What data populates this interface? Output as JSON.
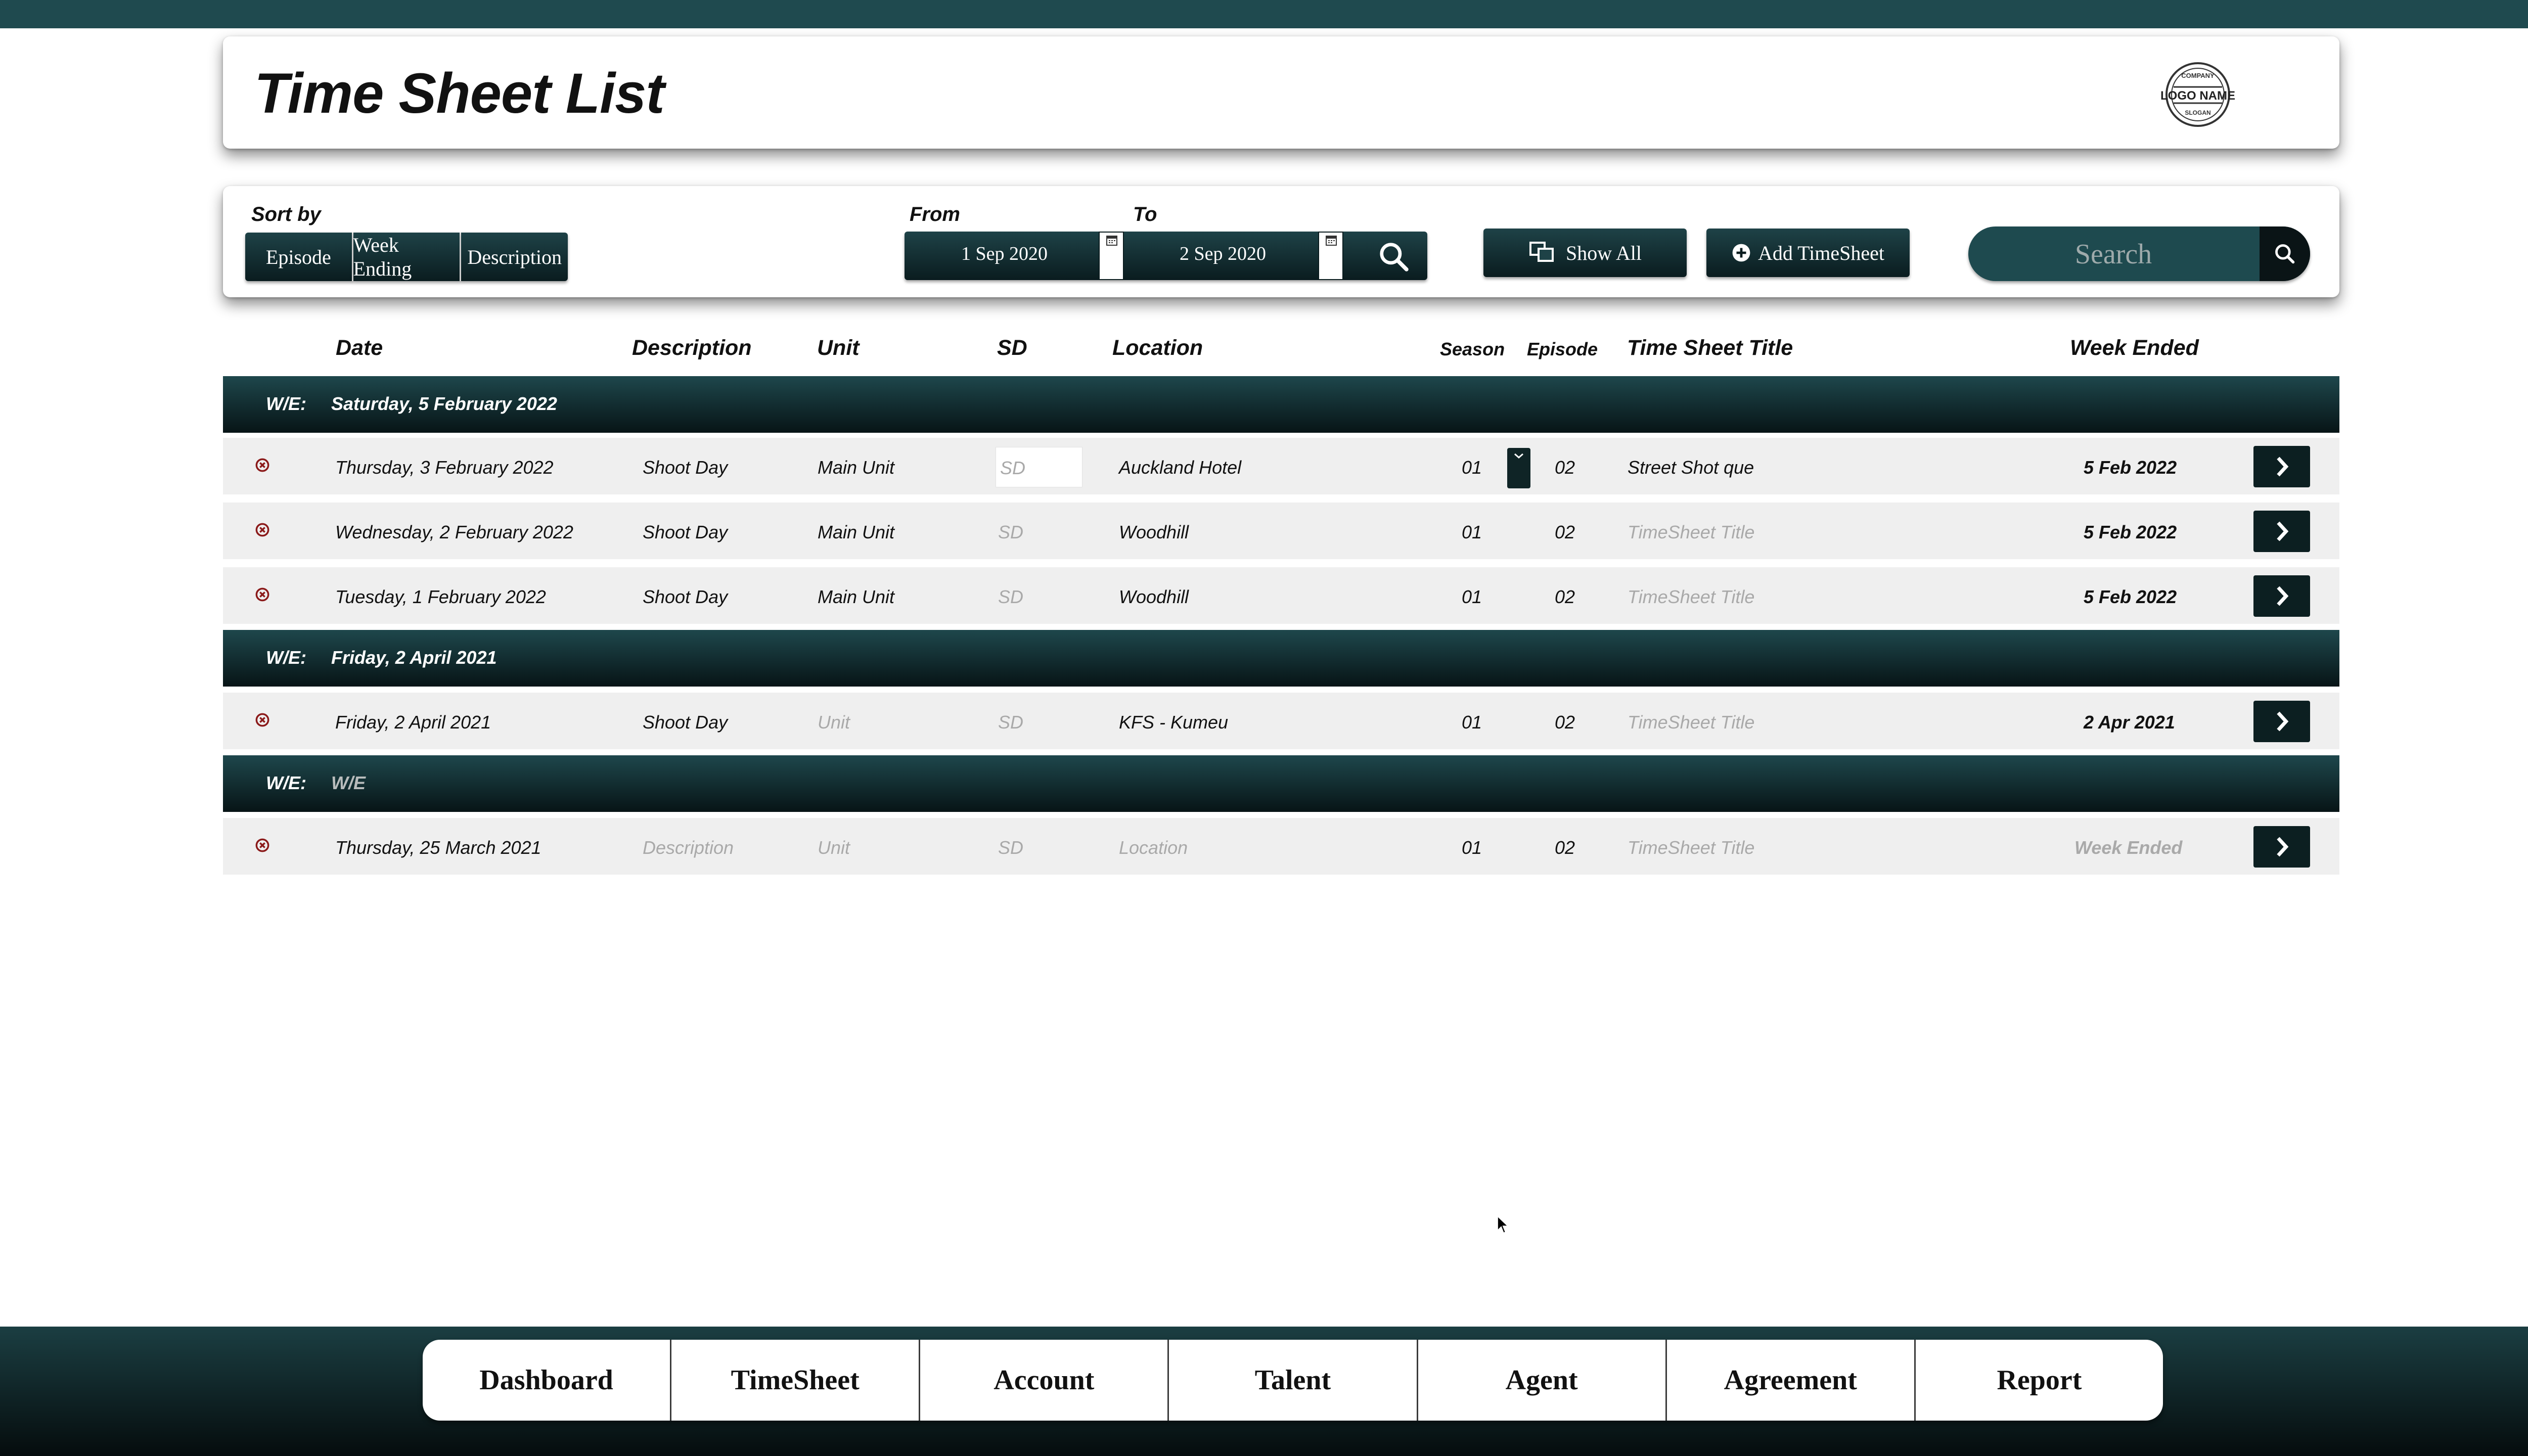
{
  "page": {
    "title": "Time Sheet List"
  },
  "logo": {
    "line1": "COMPANY",
    "line2": "LOGO NAME",
    "line3": "SLOGAN"
  },
  "filters": {
    "sort_label": "Sort by",
    "sort_options": [
      "Episode",
      "Week Ending",
      "Description"
    ],
    "from_label": "From",
    "to_label": "To",
    "from_date": "1 Sep 2020",
    "to_date": "2 Sep 2020",
    "show_all_label": "Show All",
    "add_label": "Add TimeSheet",
    "search_placeholder": "Search"
  },
  "columns": {
    "date": "Date",
    "description": "Description",
    "unit": "Unit",
    "sd": "SD",
    "location": "Location",
    "season": "Season",
    "episode": "Episode",
    "title": "Time Sheet Title",
    "week_ended": "Week Ended"
  },
  "groups": [
    {
      "we_label": "W/E:",
      "we_date": "Saturday, 5 February 2022",
      "rows": [
        {
          "date": "Thursday, 3 February 2022",
          "description": "Shoot Day",
          "unit": "Main Unit",
          "sd": "SD",
          "location": "Auckland Hotel",
          "season": "01",
          "episode": "02",
          "title": "Street Shot que",
          "week_ended": "5 Feb 2022"
        },
        {
          "date": "Wednesday, 2 February 2022",
          "description": "Shoot Day",
          "unit": "Main Unit",
          "sd": "SD",
          "location": "Woodhill",
          "season": "01",
          "episode": "02",
          "title": "TimeSheet Title",
          "week_ended": "5 Feb 2022"
        },
        {
          "date": "Tuesday, 1 February 2022",
          "description": "Shoot Day",
          "unit": "Main Unit",
          "sd": "SD",
          "location": "Woodhill",
          "season": "01",
          "episode": "02",
          "title": "TimeSheet Title",
          "week_ended": "5 Feb 2022"
        }
      ]
    },
    {
      "we_label": "W/E:",
      "we_date": "Friday, 2 April 2021",
      "rows": [
        {
          "date": "Friday, 2 April 2021",
          "description": "Shoot Day",
          "unit": "Unit",
          "sd": "SD",
          "location": "KFS - Kumeu",
          "season": "01",
          "episode": "02",
          "title": "TimeSheet Title",
          "week_ended": "2 Apr 2021"
        }
      ]
    },
    {
      "we_label": "W/E:",
      "we_date": "W/E",
      "rows": [
        {
          "date": "Thursday, 25 March 2021",
          "description": "Description",
          "unit": "Unit",
          "sd": "SD",
          "location": "Location",
          "season": "01",
          "episode": "02",
          "title": "TimeSheet Title",
          "week_ended": "Week Ended"
        }
      ]
    }
  ],
  "nav": [
    "Dashboard",
    "TimeSheet",
    "Account",
    "Talent",
    "Agent",
    "Agreement",
    "Report"
  ],
  "colors": {
    "primary": "#1e4a4f",
    "dark": "#0a1c1f",
    "delete": "#8b1a1a",
    "row_bg": "#efefef"
  }
}
